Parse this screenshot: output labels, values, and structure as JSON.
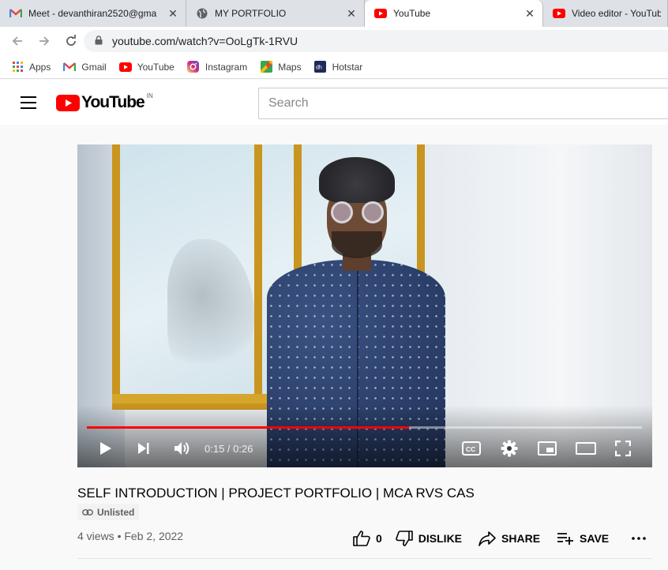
{
  "browser": {
    "tabs": [
      {
        "title": "Meet - devanthiran2520@gma",
        "icon": "gmail-icon"
      },
      {
        "title": "MY PORTFOLIO",
        "icon": "globe-icon"
      },
      {
        "title": "YouTube",
        "icon": "youtube-icon"
      },
      {
        "title": "Video editor - YouTube",
        "icon": "youtube-icon"
      }
    ],
    "url": "youtube.com/watch?v=OoLgTk-1RVU",
    "bookmarks": [
      {
        "label": "Apps",
        "icon": "apps-grid-icon"
      },
      {
        "label": "Gmail",
        "icon": "gmail-icon"
      },
      {
        "label": "YouTube",
        "icon": "youtube-icon"
      },
      {
        "label": "Instagram",
        "icon": "instagram-icon"
      },
      {
        "label": "Maps",
        "icon": "maps-icon"
      },
      {
        "label": "Hotstar",
        "icon": "hotstar-icon"
      }
    ]
  },
  "youtube": {
    "logo_text": "YouTube",
    "country": "IN",
    "search_placeholder": "Search"
  },
  "player": {
    "time": "0:15 / 0:26",
    "progress": 0.58
  },
  "video": {
    "title": "SELF INTRODUCTION | PROJECT PORTFOLIO | MCA RVS CAS",
    "visibility": "Unlisted",
    "meta": "4 views • Feb 2, 2022",
    "likes": "0",
    "dislike_label": "DISLIKE",
    "share_label": "SHARE",
    "save_label": "SAVE"
  },
  "colors": {
    "youtube_red": "#ff0000",
    "window_frame": "#c9951f"
  }
}
